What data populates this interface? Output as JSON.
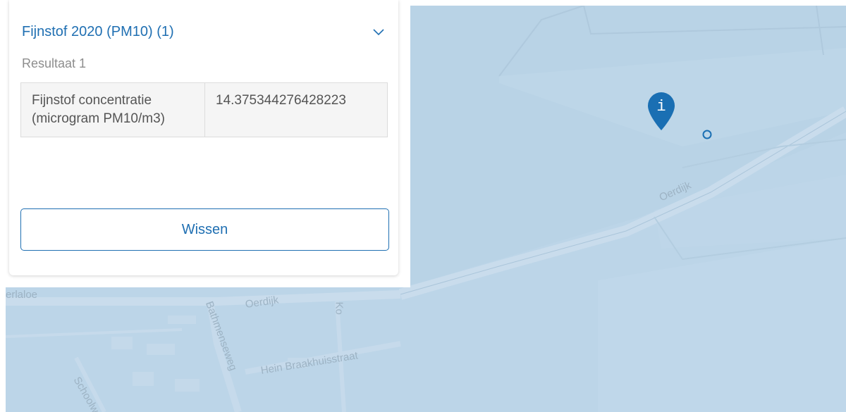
{
  "popup": {
    "layer_title": "Fijnstof 2020 (PM10) (1)",
    "result_label": "Resultaat 1",
    "attributes": [
      {
        "key": "Fijnstof concentratie (microgram PM10/m3)",
        "value": "14.375344276428223"
      }
    ],
    "clear_button_label": "Wissen"
  },
  "map": {
    "road_labels": [
      "Oerdijk",
      "Oerdijk",
      "Bathmenseweg",
      "Hein Braakhuisstraat",
      "Schoolweg",
      "erlaloe",
      "Ko"
    ],
    "marker_icon": "info-marker-icon",
    "marker_label": "i",
    "location_icon": "location-ring-icon"
  },
  "colors": {
    "accent": "#1f6fb2",
    "map_water": "#b9d3e6",
    "marker": "#1a6fb3"
  }
}
